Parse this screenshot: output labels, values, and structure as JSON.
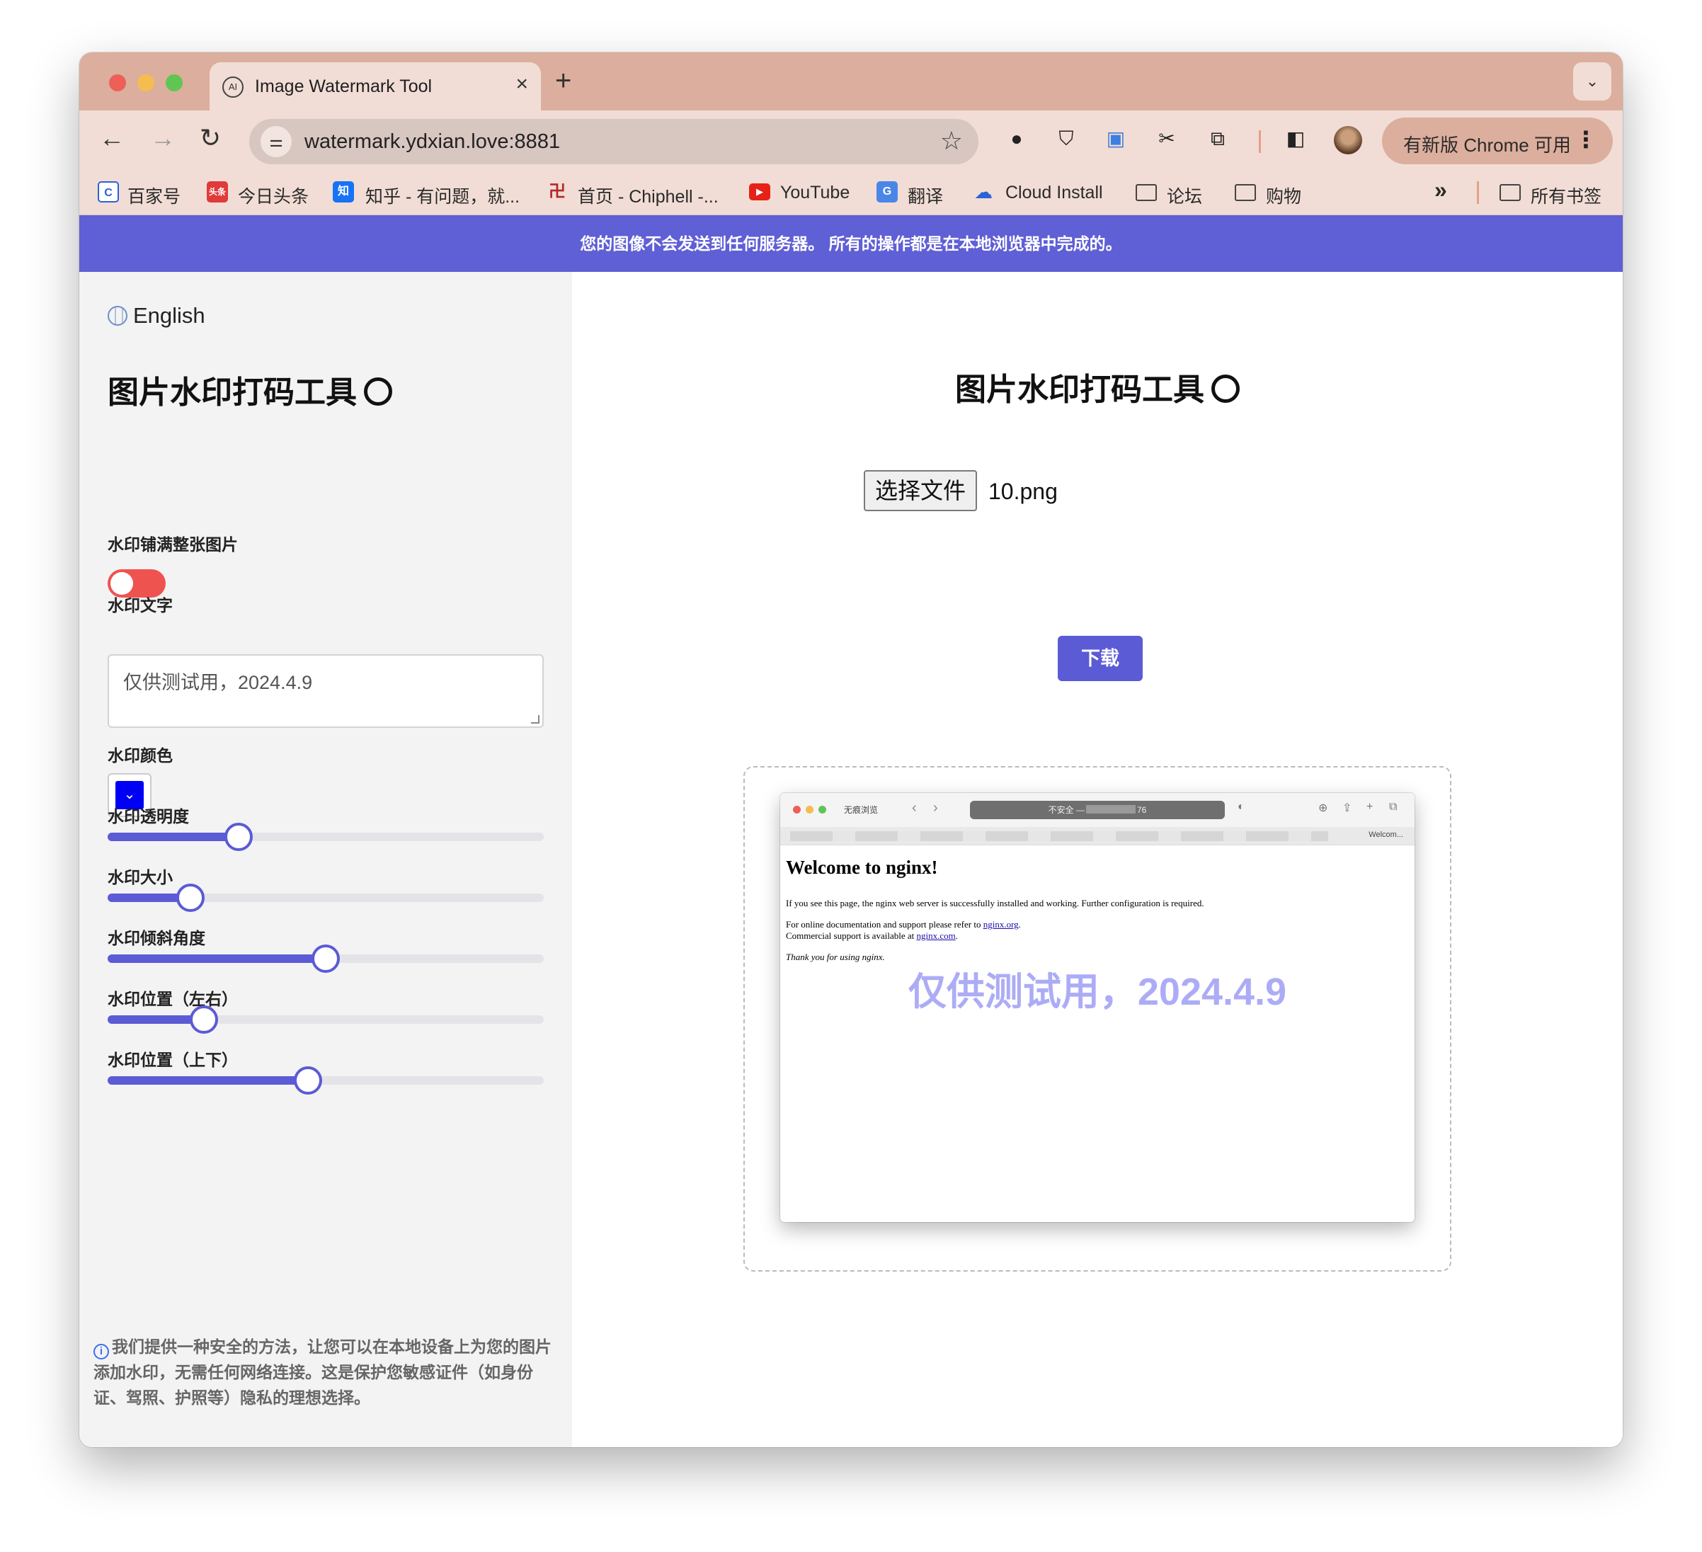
{
  "browser": {
    "tab_title": "Image Watermark Tool",
    "tab_favicon_text": "AI",
    "url": "watermark.ydxian.love:8881",
    "update_label": "有新版 Chrome 可用",
    "bookmarks": [
      {
        "label": "百家号",
        "icon": "baijiahao-icon"
      },
      {
        "label": "今日头条",
        "icon": "toutiao-icon",
        "icon_text": "头条"
      },
      {
        "label": "知乎 - 有问题，就...",
        "icon": "zhihu-icon",
        "icon_text": "知"
      },
      {
        "label": "首页 - Chiphell -...",
        "icon": "chiphell-icon"
      },
      {
        "label": "YouTube",
        "icon": "youtube-icon"
      },
      {
        "label": "翻译",
        "icon": "translate-icon"
      },
      {
        "label": "Cloud Install",
        "icon": "cloud-icon"
      },
      {
        "label": "论坛",
        "icon": "folder-icon"
      },
      {
        "label": "购物",
        "icon": "folder-icon"
      }
    ],
    "overflow_label": "»",
    "all_bookmarks_label": "所有书签"
  },
  "banner": "您的图像不会发送到任何服务器。 所有的操作都是在本地浏览器中完成的。",
  "sidebar": {
    "language": "English",
    "title": "图片水印打码工具",
    "fill_label": "水印铺满整张图片",
    "fill_enabled": false,
    "text_label": "水印文字",
    "text_value": "仅供测试用，2024.4.9",
    "color_label": "水印颜色",
    "color_value": "#0000f5",
    "opacity_label": "水印透明度",
    "opacity_value": 0.3,
    "size_label": "水印大小",
    "size_value": 0.19,
    "angle_label": "水印倾斜角度",
    "angle_value": 0.5,
    "pos_x_label": "水印位置（左右）",
    "pos_x_value": 0.22,
    "pos_y_label": "水印位置（上下）",
    "pos_y_value": 0.46,
    "info_text": "我们提供一种安全的方法，让您可以在本地设备上为您的图片添加水印，无需任何网络连接。这是保护您敏感证件（如身份证、驾照、护照等）隐私的理想选择。"
  },
  "main": {
    "title": "图片水印打码工具",
    "file_button": "选择文件",
    "file_name": "10.png",
    "download_button": "下载",
    "preview": {
      "tab_name": "无痕浏览",
      "url_prefix": "不安全 —",
      "url_suffix": "76",
      "tab2": "Welcom...",
      "heading": "Welcome to nginx!",
      "p1": "If you see this page, the nginx web server is successfully installed and working. Further configuration is required.",
      "p2_prefix": "For online documentation and support please refer to",
      "p2_link": "nginx.org",
      "p3_prefix": "Commercial support is available at",
      "p3_link": "nginx.com",
      "p4": "Thank you for using nginx.",
      "watermark": "仅供测试用，2024.4.9"
    }
  }
}
